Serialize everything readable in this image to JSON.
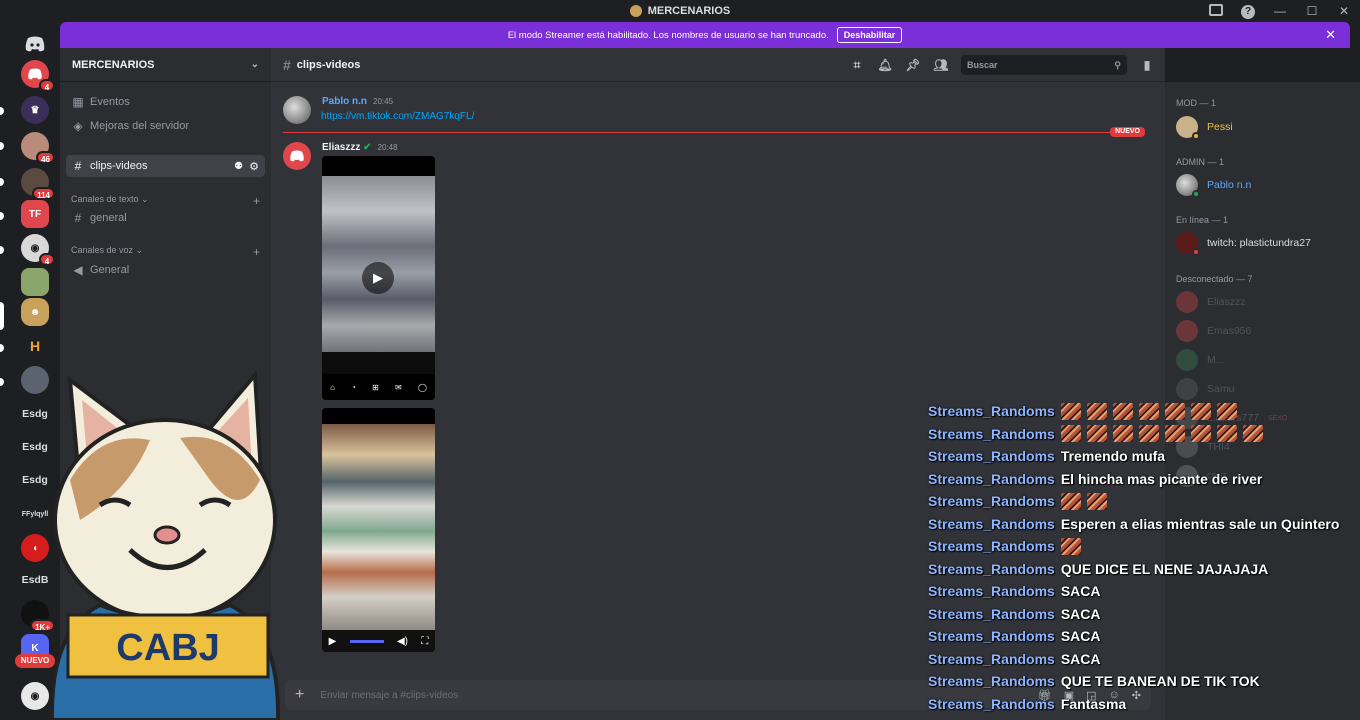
{
  "window": {
    "title": "MERCENARIOS"
  },
  "banner": {
    "text": "El modo Streamer está habilitado. Los nombres de usuario se han truncado.",
    "button": "Deshabilitar"
  },
  "rail": {
    "badges": [
      "4",
      "46",
      "114",
      "4",
      "1K+"
    ],
    "text_servers": [
      "Esdg",
      "Esdg",
      "Esdg",
      "FFylqyll",
      "EsdB"
    ],
    "new_label": "NUEVO"
  },
  "sidebar": {
    "server_name": "MERCENARIOS",
    "events": "Eventos",
    "boosts": "Mejoras del servidor",
    "active_channel": "clips-videos",
    "text_category": "Canales de texto",
    "text_channel": "general",
    "voice_category": "Canales de voz",
    "voice_channel": "General"
  },
  "header": {
    "channel": "clips-videos",
    "search_placeholder": "Buscar"
  },
  "messages": [
    {
      "author": "Pablo n.n",
      "time": "20:45",
      "link": "https://vm.tiktok.com/ZMAG7kqFL/"
    },
    {
      "author": "Eliaszzz",
      "time": "20:48"
    }
  ],
  "new_label": "NUEVO",
  "input": {
    "placeholder": "Enviar mensaje a #clips-videos"
  },
  "members": {
    "mod_cat": "MOD — 1",
    "mod": [
      "Pessi"
    ],
    "admin_cat": "ADMIN — 1",
    "admin": [
      "Pablo n.n"
    ],
    "online_cat": "En línea — 1",
    "online": [
      "twitch: plastictundra27"
    ],
    "offline_cat": "Desconectado — 7",
    "offline": [
      "Eliaszzz",
      "Emas956",
      "M...",
      "Samu",
      "...aiters777",
      "THI4",
      "CRNT"
    ],
    "offline_tags": [
      "SEXO"
    ]
  },
  "stream_chat": [
    {
      "user": "Streams_Randoms",
      "msg": "",
      "emotes": 7
    },
    {
      "user": "Streams_Randoms",
      "msg": "",
      "emotes": 8
    },
    {
      "user": "Streams_Randoms",
      "msg": "Tremendo mufa",
      "emotes": 0
    },
    {
      "user": "Streams_Randoms",
      "msg": "El hincha mas picante de river",
      "emotes": 0
    },
    {
      "user": "Streams_Randoms",
      "msg": "",
      "emotes": 2
    },
    {
      "user": "Streams_Randoms",
      "msg": "Esperen a elias mientras sale un Quintero",
      "emotes": 0
    },
    {
      "user": "Streams_Randoms",
      "msg": "",
      "emotes": 1
    },
    {
      "user": "Streams_Randoms",
      "msg": "QUE DICE EL NENE JAJAJAJA",
      "emotes": 0
    },
    {
      "user": "Streams_Randoms",
      "msg": "SACA",
      "emotes": 0
    },
    {
      "user": "Streams_Randoms",
      "msg": "SACA",
      "emotes": 0
    },
    {
      "user": "Streams_Randoms",
      "msg": "SACA",
      "emotes": 0
    },
    {
      "user": "Streams_Randoms",
      "msg": "SACA",
      "emotes": 0
    },
    {
      "user": "Streams_Randoms",
      "msg": "QUE TE BANEAN DE TIK TOK",
      "emotes": 0
    },
    {
      "user": "Streams_Randoms",
      "msg": "Fantasma",
      "emotes": 0
    }
  ],
  "overlay_shirt_text": "CABJ",
  "colors": {
    "banner": "#7b2fd8",
    "accent": "#5865f2",
    "link": "#00a8fc",
    "mod": "#f0c14b",
    "admin": "#5aa9ff",
    "new": "#e03b3b"
  }
}
